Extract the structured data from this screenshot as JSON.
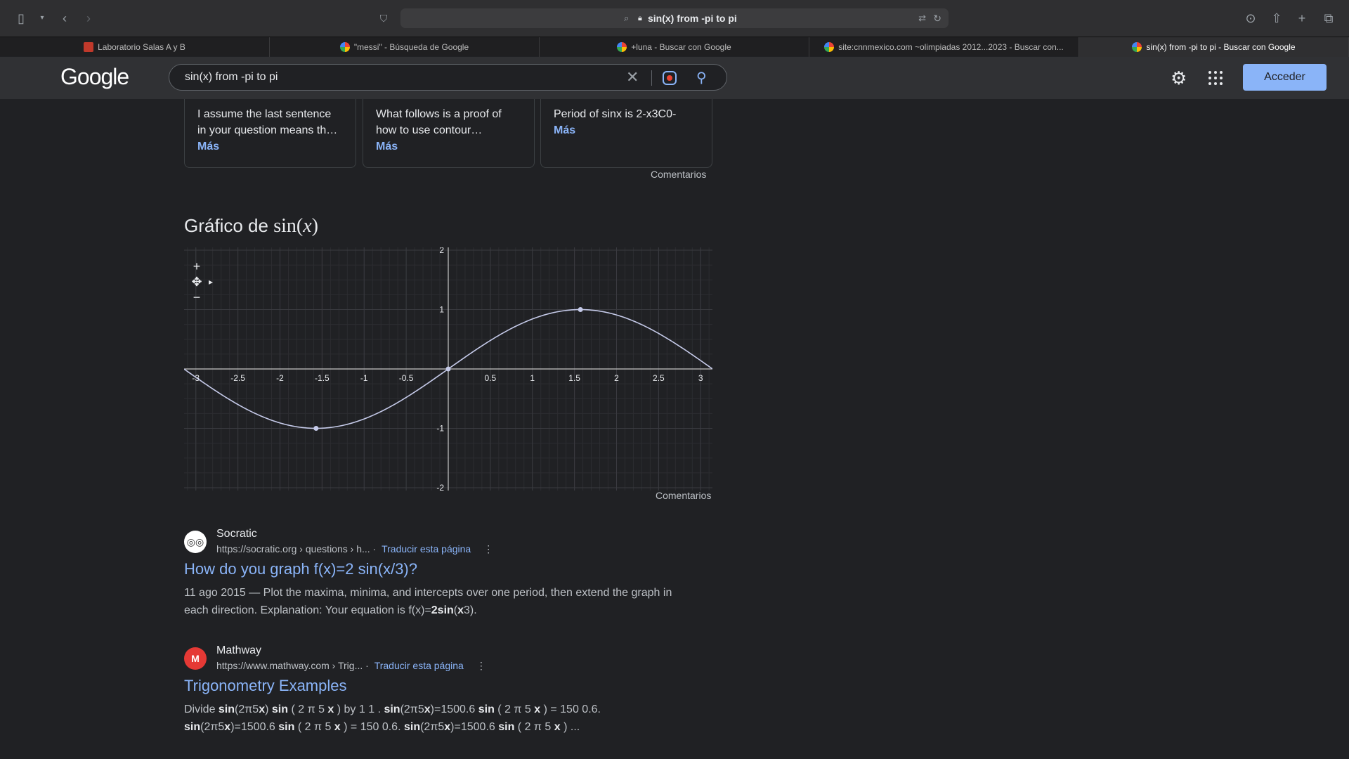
{
  "browser": {
    "address": "sin(x) from -pi to pi",
    "tabs": [
      {
        "label": "Laboratorio Salas A y B",
        "favicon": "lab-icon"
      },
      {
        "label": "\"messi\" - Búsqueda de Google",
        "favicon": "google-icon"
      },
      {
        "label": "+luna - Buscar con Google",
        "favicon": "google-icon"
      },
      {
        "label": "site:cnnmexico.com ~olimpiadas 2012...2023 - Buscar con...",
        "favicon": "google-icon"
      },
      {
        "label": "sin(x) from -pi to pi - Buscar con Google",
        "favicon": "google-icon"
      }
    ]
  },
  "google": {
    "logo": "Google",
    "query": "sin(x) from -pi to pi",
    "signin_label": "Acceder"
  },
  "cards": [
    {
      "text": "I assume the last sentence in your question means th…",
      "more": "Más"
    },
    {
      "text": "What follows is a proof of how to use contour…",
      "more": "Más"
    },
    {
      "text": "Period of sinx is 2-x3C0-",
      "more": "Más"
    }
  ],
  "feedback_label": "Comentarios",
  "graph": {
    "title_prefix": "Gráfico de",
    "title_fn": "sin(",
    "title_var": "x",
    "title_close": ")",
    "feedback": "Comentarios",
    "zoom_in": "+",
    "zoom_out": "−"
  },
  "chart_data": {
    "type": "line",
    "function": "sin(x)",
    "xlim": [
      -3.14,
      3.14
    ],
    "ylim": [
      -2,
      2
    ],
    "x_ticks": [
      -3,
      -2.5,
      -2,
      -1.5,
      -1,
      -0.5,
      0.5,
      1,
      1.5,
      2,
      2.5,
      3
    ],
    "x_tick_labels": [
      "-3",
      "-2.5",
      "-2",
      "-1.5",
      "-1",
      "-0.5",
      "0.5",
      "1",
      "1.5",
      "2",
      "2.5",
      "3"
    ],
    "y_ticks": [
      -2,
      -1,
      1,
      2
    ],
    "y_tick_labels": [
      "-2",
      "-1",
      "1",
      "2"
    ],
    "grid": true,
    "marked_points": [
      {
        "x": -1.571,
        "y": -1
      },
      {
        "x": 0,
        "y": 0
      },
      {
        "x": 1.571,
        "y": 1
      }
    ],
    "line_color": "#c5cae9"
  },
  "results": [
    {
      "site": "Socratic",
      "url": "https://socratic.org › questions › h...",
      "translate": "Traducir esta página",
      "title": "How do you graph f(x)=2 sin(x/3)?",
      "snippet_html": "11 ago 2015 — Plot the maxima, minima, and intercepts over one period, then extend the graph in each direction. Explanation: Your equation is f(x)=<b>2sin</b>(<b>x</b>3)."
    },
    {
      "site": "Mathway",
      "url": "https://www.mathway.com › Trig...",
      "translate": "Traducir esta página",
      "title": "Trigonometry Examples",
      "snippet_html": "Divide <b>sin</b>(2π5<b>x</b>) <b>sin</b> ( 2 π 5 <b>x</b> ) by 1 1 . <b>sin</b>(2π5<b>x</b>)=1500.6 <b>sin</b> ( 2 π 5 <b>x</b> ) = 150 0.6. <b>sin</b>(2π5<b>x</b>)=1500.6 <b>sin</b> ( 2 π 5 <b>x</b> ) = 150 0.6. <b>sin</b>(2π5<b>x</b>)=1500.6 <b>sin</b> ( 2 π 5 <b>x</b> ) ..."
    }
  ]
}
